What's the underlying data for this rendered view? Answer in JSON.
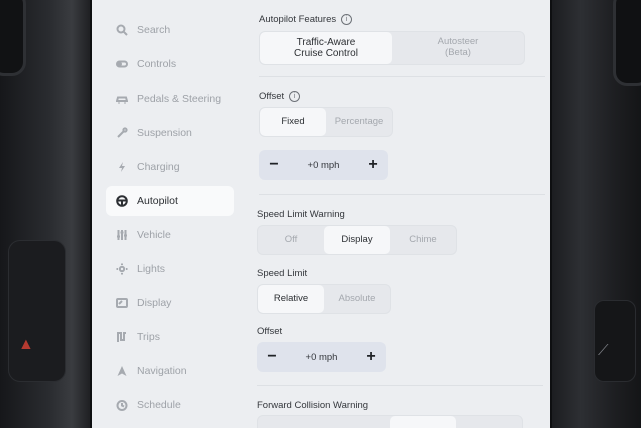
{
  "sidebar": {
    "items": [
      {
        "label": "Search",
        "icon": "search-icon",
        "active": false
      },
      {
        "label": "Controls",
        "icon": "toggle-icon",
        "active": false
      },
      {
        "label": "Pedals & Steering",
        "icon": "car-icon",
        "active": false
      },
      {
        "label": "Suspension",
        "icon": "wrench-icon",
        "active": false
      },
      {
        "label": "Charging",
        "icon": "lightning-icon",
        "active": false
      },
      {
        "label": "Autopilot",
        "icon": "steering-wheel-icon",
        "active": true
      },
      {
        "label": "Vehicle",
        "icon": "sliders-icon",
        "active": false
      },
      {
        "label": "Lights",
        "icon": "sun-icon",
        "active": false
      },
      {
        "label": "Display",
        "icon": "display-icon",
        "active": false
      },
      {
        "label": "Trips",
        "icon": "trips-icon",
        "active": false
      },
      {
        "label": "Navigation",
        "icon": "navigation-arrow-icon",
        "active": false
      },
      {
        "label": "Schedule",
        "icon": "clock-icon",
        "active": false
      }
    ]
  },
  "autopilot_features": {
    "label": "Autopilot Features",
    "options": [
      "Traffic-Aware\nCruise Control",
      "Autosteer\n(Beta)"
    ],
    "selected": 0
  },
  "offset_1": {
    "label": "Offset",
    "options": [
      "Fixed",
      "Percentage"
    ],
    "selected": 0,
    "value": "+0 mph",
    "minus": "−",
    "plus": "+"
  },
  "speed_limit_warning": {
    "label": "Speed Limit Warning",
    "options": [
      "Off",
      "Display",
      "Chime"
    ],
    "selected": 1
  },
  "speed_limit": {
    "label": "Speed Limit",
    "options": [
      "Relative",
      "Absolute"
    ],
    "selected": 0
  },
  "offset_2": {
    "label": "Offset",
    "value": "+0 mph",
    "minus": "−",
    "plus": "+"
  },
  "forward_collision_warning": {
    "label": "Forward Collision Warning"
  },
  "colors": {
    "screen_bg": "#eceef1",
    "selected_option": "#f6f7f9",
    "stepper_bg": "#dfe3ec",
    "hazard": "#b53a30"
  }
}
